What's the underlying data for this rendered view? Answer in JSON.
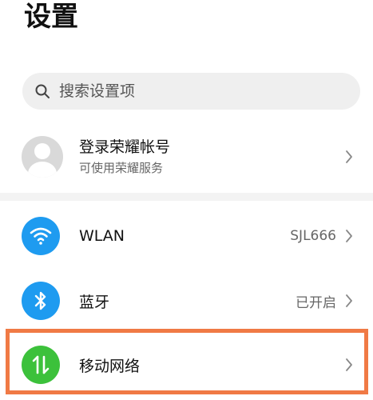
{
  "page": {
    "title": "设置"
  },
  "search": {
    "placeholder": "搜索设置项"
  },
  "account": {
    "title": "登录荣耀帐号",
    "subtitle": "可使用荣耀服务"
  },
  "settings": [
    {
      "label": "WLAN",
      "value": "SJL666",
      "icon": "wifi-icon",
      "color": "#1e9bf0"
    },
    {
      "label": "蓝牙",
      "value": "已开启",
      "icon": "bluetooth-icon",
      "color": "#1e9bf0"
    },
    {
      "label": "移动网络",
      "value": "",
      "icon": "mobile-data-icon",
      "color": "#3cc13b"
    }
  ],
  "colors": {
    "highlight": "#f07a45",
    "blue": "#1e9bf0",
    "green": "#3cc13b"
  }
}
